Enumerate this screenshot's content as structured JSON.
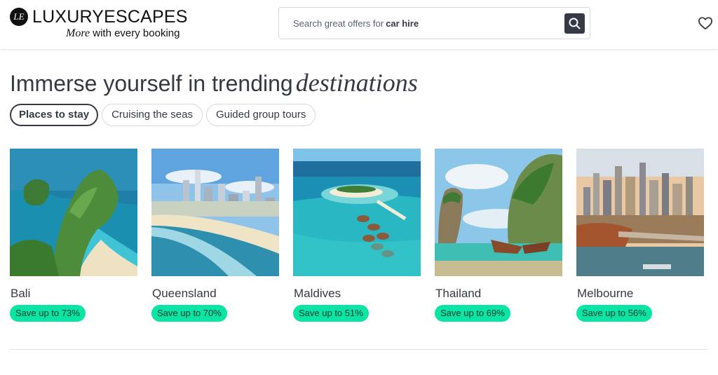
{
  "brand": {
    "mark": "LE",
    "wordmark": "LUXURYESCAPES",
    "tagline_italic": "More",
    "tagline_rest": "with every booking"
  },
  "search": {
    "prefix": "Search great offers for",
    "highlight": "car hire",
    "button_icon": "search-icon"
  },
  "header_actions": {
    "wishlist_icon": "heart-icon"
  },
  "section": {
    "title_plain": "Immerse yourself in trending",
    "title_italic": "destinations"
  },
  "tabs": [
    {
      "label": "Places to stay",
      "active": true
    },
    {
      "label": "Cruising the seas",
      "active": false
    },
    {
      "label": "Guided group tours",
      "active": false
    }
  ],
  "destinations": [
    {
      "name": "Bali",
      "badge": "Save up to 73%"
    },
    {
      "name": "Queensland",
      "badge": "Save up to 70%"
    },
    {
      "name": "Maldives",
      "badge": "Save up to 51%"
    },
    {
      "name": "Thailand",
      "badge": "Save up to 69%"
    },
    {
      "name": "Melbourne",
      "badge": "Save up to 56%"
    }
  ],
  "colors": {
    "text": "#363a45",
    "badge": "#0be5a3",
    "border": "#d6d8dc"
  }
}
